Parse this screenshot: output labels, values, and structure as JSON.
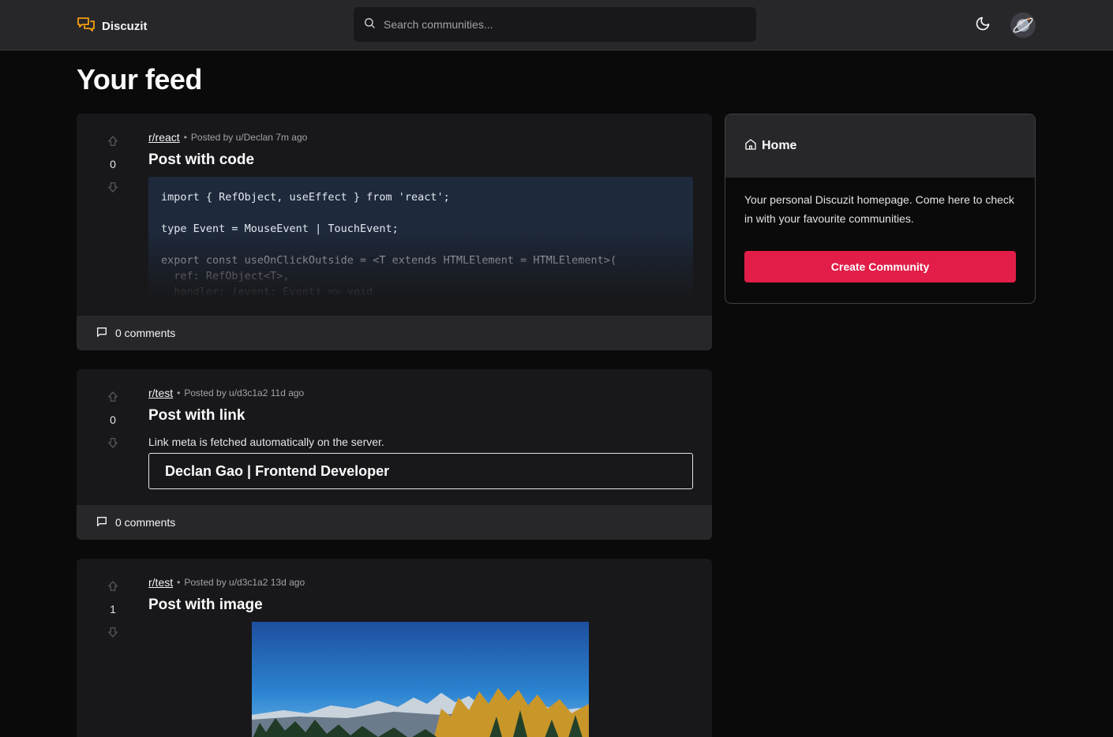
{
  "header": {
    "brand_name": "Discuzit",
    "search_placeholder": "Search communities...",
    "theme_icon": "moon-icon",
    "avatar_icon": "planet-icon"
  },
  "page_title": "Your feed",
  "posts": [
    {
      "community": "r/react",
      "meta": "Posted by u/Declan 7m ago",
      "title": "Post with code",
      "votes": "0",
      "code_lines": [
        "import { RefObject, useEffect } from 'react';",
        "",
        "type Event = MouseEvent | TouchEvent;",
        "",
        "export const useOnClickOutside = <T extends HTMLElement = HTMLElement>(",
        "  ref: RefObject<T>,",
        "  handler: (event: Event) => void"
      ],
      "comments": "0 comments"
    },
    {
      "community": "r/test",
      "meta": "Posted by u/d3c1a2 11d ago",
      "title": "Post with link",
      "votes": "0",
      "text": "Link meta is fetched automatically on the server.",
      "link_title": "Declan Gao | Frontend Developer",
      "comments": "0 comments"
    },
    {
      "community": "r/test",
      "meta": "Posted by u/d3c1a2 13d ago",
      "title": "Post with image",
      "votes": "1",
      "image_icon": "mountain-landscape-image"
    }
  ],
  "sidebar": {
    "title": "Home",
    "description": "Your personal Discuzit homepage. Come here to check in with your favourite communities.",
    "button_label": "Create Community"
  },
  "colors": {
    "accent": "#e11d48",
    "brand_icon": "#f59e0b",
    "background": "#0a0a0a",
    "card": "#18181b",
    "bar": "#27272a"
  }
}
